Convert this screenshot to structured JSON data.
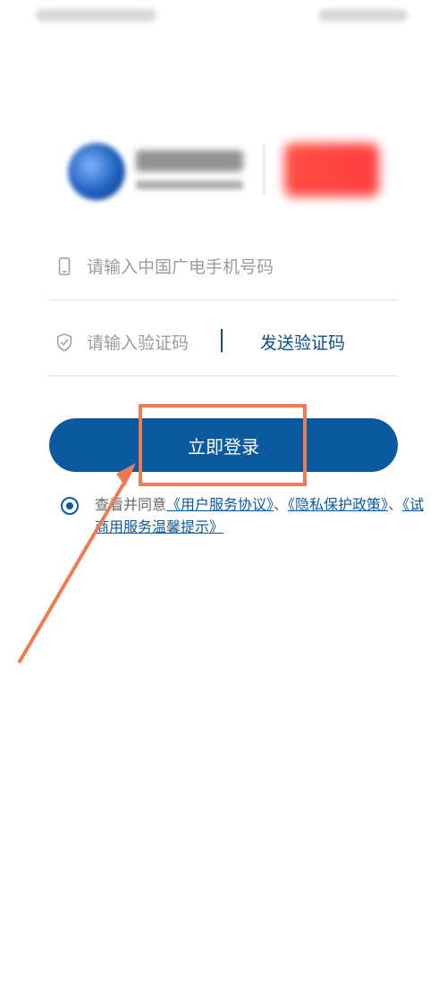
{
  "login": {
    "phone_placeholder": "请输入中国广电手机号码",
    "code_placeholder": "请输入验证码",
    "send_code_label": "发送验证码",
    "login_button_label": "立即登录"
  },
  "agreement": {
    "prefix": "查看并同意",
    "link_service": "《用户服务协议》",
    "separator1": "、",
    "link_privacy": "《隐私保护政策》",
    "separator2": "、",
    "link_trial": "《试商用服务温馨提示》"
  },
  "colors": {
    "primary": "#0b5aa0",
    "annotation": "#f07b50"
  }
}
